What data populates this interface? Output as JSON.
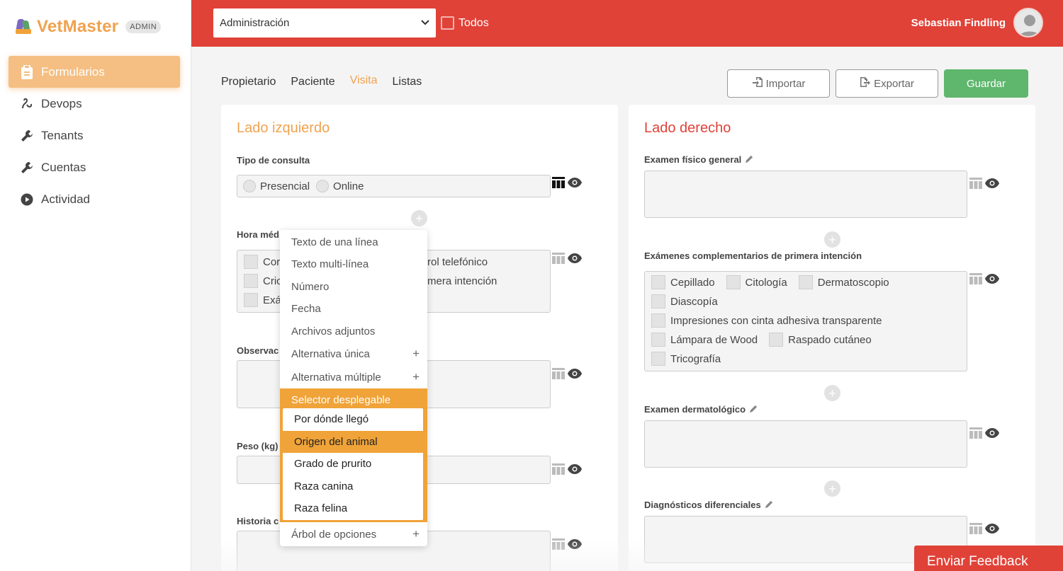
{
  "app": {
    "name": "VetMaster",
    "badge": "ADMIN"
  },
  "sidebar": {
    "items": [
      {
        "label": "Formularios",
        "icon": "clipboard-icon",
        "active": true
      },
      {
        "label": "Devops",
        "icon": "devops-icon"
      },
      {
        "label": "Tenants",
        "icon": "wrench-icon"
      },
      {
        "label": "Cuentas",
        "icon": "wrench-icon"
      },
      {
        "label": "Actividad",
        "icon": "play-circle-icon"
      }
    ]
  },
  "header": {
    "select_value": "Administración",
    "todos_label": "Todos",
    "user_name": "Sebastian Findling"
  },
  "tabs": [
    "Propietario",
    "Paciente",
    "Visita",
    "Listas"
  ],
  "active_tab": "Visita",
  "actions": {
    "import": "Importar",
    "export": "Exportar",
    "save": "Guardar"
  },
  "left": {
    "title": "Lado izquierdo",
    "tipo_consulta": {
      "label": "Tipo de consulta",
      "options": [
        "Presencial",
        "Online"
      ]
    },
    "hora_label": "Hora méd",
    "hora_options": [
      "Cor",
      "Cric",
      "Exá"
    ],
    "hora_right": [
      "rol telefónico",
      "mera intención"
    ],
    "observ_label": "Observac",
    "peso_label": "Peso (kg)",
    "historia_label": "Historia c"
  },
  "right": {
    "title": "Lado derecho",
    "examen_fisico": "Examen físico general",
    "examenes_comp": "Exámenes complementarios de primera intención",
    "exam_options": {
      "row1": [
        "Cepillado",
        "Citología",
        "Dermatoscopio"
      ],
      "row2": [
        "Diascopía"
      ],
      "row3": [
        "Impresiones con cinta adhesiva transparente"
      ],
      "row4": [
        "Lámpara de Wood",
        "Raspado cutáneo"
      ],
      "row5": [
        "Tricografía"
      ]
    },
    "examen_derm": "Examen dermatológico",
    "diagnosticos": "Diagnósticos diferenciales"
  },
  "menu": {
    "items": [
      "Texto de una línea",
      "Texto multi-línea",
      "Número",
      "Fecha",
      "Archivos adjuntos",
      "Alternativa única",
      "Alternativa múltiple"
    ],
    "selected": "Selector desplegable",
    "sub_items": [
      "Por dónde llegó",
      "Origen del animal",
      "Grado de prurito",
      "Raza canina",
      "Raza felina"
    ],
    "highlighted_sub": "Origen del animal",
    "last": "Árbol de opciones"
  },
  "feedback": "Enviar Feedback",
  "colors": {
    "brand_red": "#e04238",
    "orange": "#f0a250",
    "green": "#5fb66d"
  }
}
